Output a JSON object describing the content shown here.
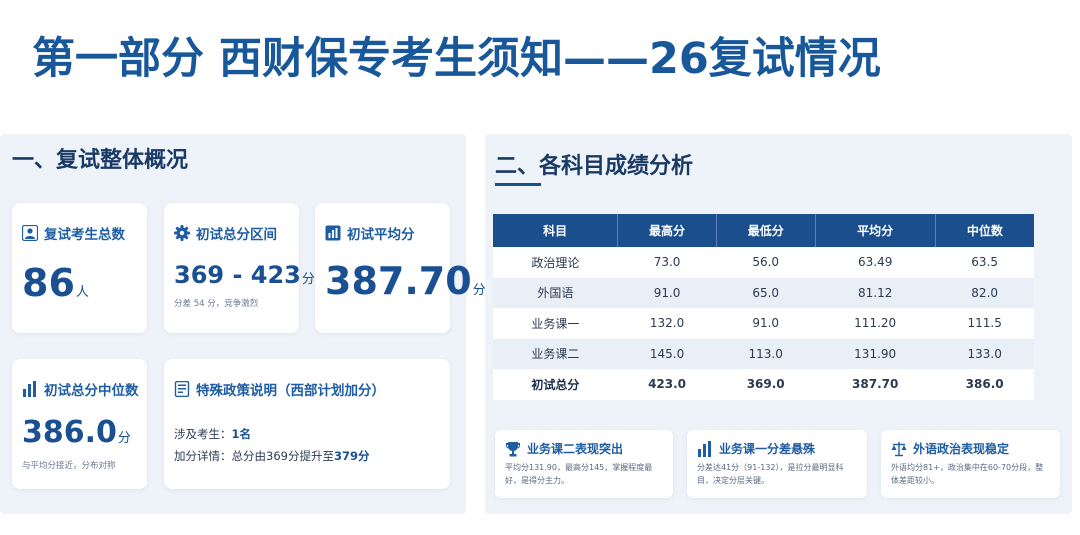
{
  "page_title": "第一部分 西财保专考生须知——26复试情况",
  "left": {
    "heading": "一、复试整体概况",
    "cards": {
      "total": {
        "label": "复试考生总数",
        "value": "86",
        "unit": "人"
      },
      "range": {
        "label": "初试总分区间",
        "value": "369 - 423",
        "unit": "分",
        "note": "分差 54 分，竞争激烈"
      },
      "average": {
        "label": "初试平均分",
        "value": "387.70",
        "unit": "分"
      },
      "median": {
        "label": "初试总分中位数",
        "value": "386.0",
        "unit": "分",
        "note": "与平均分接近，分布对称"
      },
      "policy": {
        "label": "特殊政策说明（西部计划加分）",
        "line1_label": "涉及考生：",
        "line1_value": "1名",
        "line2_label": "加分详情：总分由369分提升至",
        "line2_value": "379分"
      }
    }
  },
  "right": {
    "heading": "二、各科目成绩分析",
    "table": {
      "headers": [
        "科目",
        "最高分",
        "最低分",
        "平均分",
        "中位数"
      ],
      "rows": [
        [
          "政治理论",
          "73.0",
          "56.0",
          "63.49",
          "63.5"
        ],
        [
          "外国语",
          "91.0",
          "65.0",
          "81.12",
          "82.0"
        ],
        [
          "业务课一",
          "132.0",
          "91.0",
          "111.20",
          "111.5"
        ],
        [
          "业务课二",
          "145.0",
          "113.0",
          "131.90",
          "133.0"
        ],
        [
          "初试总分",
          "423.0",
          "369.0",
          "387.70",
          "386.0"
        ]
      ]
    },
    "insights": [
      {
        "icon": "trophy-icon",
        "title": "业务课二表现突出",
        "text": "平均分131.90，最高分145，掌握程度最好，是得分主力。"
      },
      {
        "icon": "bar-chart-icon",
        "title": "业务课一分差悬殊",
        "text": "分差达41分（91-132），是拉分最明显科目，决定分层关键。"
      },
      {
        "icon": "scale-icon",
        "title": "外语政治表现稳定",
        "text": "外语均分81+，政治集中在60-70分段，整体差距较小。"
      }
    ]
  },
  "colors": {
    "title": "#17579a",
    "accent": "#1e5da3",
    "table_header": "#1b4e8c",
    "panel_bg": "#eef3f9"
  }
}
